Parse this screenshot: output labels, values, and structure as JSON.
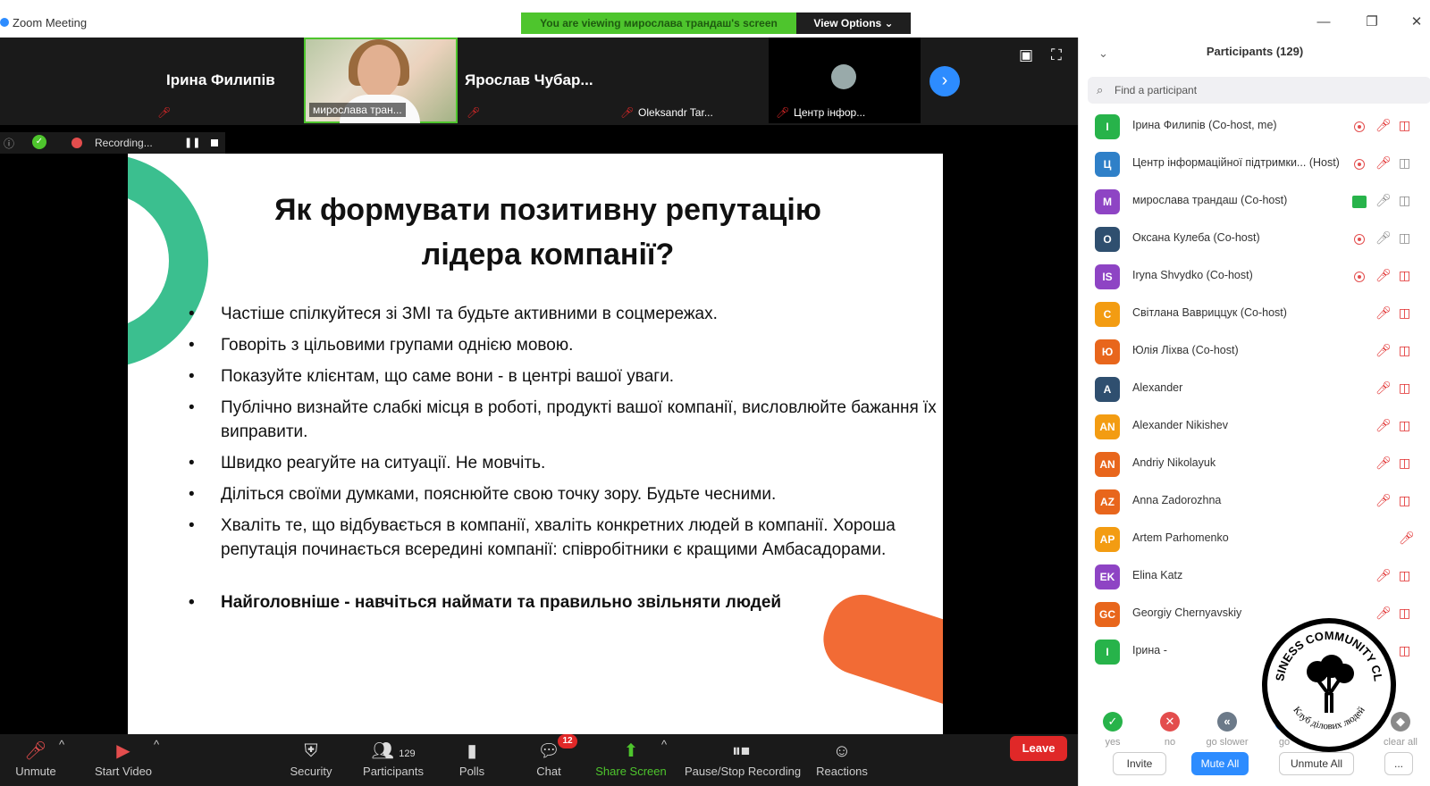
{
  "window": {
    "title": "Zoom Meeting",
    "viewing_banner": "You are viewing мирослава трандаш's screen",
    "view_options": "View Options ⌄"
  },
  "thumbnails": [
    {
      "name": "Ірина Филипів",
      "label": ""
    },
    {
      "name": "",
      "label": "мирослава тран..."
    },
    {
      "name": "Ярослав  Чубар...",
      "label": ""
    },
    {
      "name": "",
      "label": "Oleksandr Tar..."
    },
    {
      "name": "",
      "label": "Центр інфор..."
    }
  ],
  "recording": {
    "text": "Recording..."
  },
  "slide": {
    "title": "Як формувати позитивну репутацію\nлідера компанії?",
    "bullets": [
      "Частіше спілкуйтеся зі ЗМІ та будьте активними в соцмережах.",
      "Говоріть з цільовими групами однією мовою.",
      "Показуйте клієнтам, що саме вони - в центрі вашої уваги.",
      "Публічно визнайте слабкі місця в роботі, продукті вашої компанії, висловлюйте бажання їх виправити.",
      "Швидко реагуйте на ситуації. Не мовчіть.",
      "Діліться своїми думками, пояснюйте свою точку зору. Будьте чесними.",
      "Хваліть те, що відбувається в компанії, хваліть конкретних людей в компанії. Хороша репутація починається всередині компанії: співробітники є кращими Амбасадорами.",
      "Найголовніше - навчіться наймати та правильно звільняти людей"
    ]
  },
  "toolbar": {
    "unmute": "Unmute",
    "start_video": "Start Video",
    "security": "Security",
    "participants": "Participants",
    "participants_count": "129",
    "polls": "Polls",
    "chat": "Chat",
    "chat_badge": "12",
    "share_screen": "Share Screen",
    "pause_stop_recording": "Pause/Stop Recording",
    "reactions": "Reactions",
    "leave": "Leave"
  },
  "panel": {
    "title": "Participants (129)",
    "search_placeholder": "Find a participant",
    "participants": [
      {
        "initials": "І",
        "color": "#27b34a",
        "name": "Ірина Филипів (Co-host, me)"
      },
      {
        "initials": "Ц",
        "color": "#2f80c8",
        "name": "Центр інформаційної підтримки... (Host)"
      },
      {
        "initials": "М",
        "color": "#8e44c4",
        "name": "мирослава трандаш (Co-host)"
      },
      {
        "initials": "О",
        "color": "#2f4f6f",
        "name": "Оксана Кулеба (Co-host)"
      },
      {
        "initials": "IS",
        "color": "#8e44c4",
        "name": "Iryna Shvydko (Co-host)"
      },
      {
        "initials": "С",
        "color": "#f39c12",
        "name": "Світлана Вавриццук (Co-host)"
      },
      {
        "initials": "Ю",
        "color": "#e8661c",
        "name": "Юлія Ліхва (Co-host)"
      },
      {
        "initials": "A",
        "color": "#2f4f6f",
        "name": "Alexander"
      },
      {
        "initials": "AN",
        "color": "#f39c12",
        "name": "Alexander Nikishev"
      },
      {
        "initials": "AN",
        "color": "#e8661c",
        "name": "Andriy Nikolayuk"
      },
      {
        "initials": "AZ",
        "color": "#e8661c",
        "name": "Anna Zadorozhna"
      },
      {
        "initials": "AP",
        "color": "#f39c12",
        "name": "Artem Parhomenko"
      },
      {
        "initials": "EK",
        "color": "#8e44c4",
        "name": "Elina Katz"
      },
      {
        "initials": "GC",
        "color": "#e8661c",
        "name": "Georgiy Chernyavskiy"
      },
      {
        "initials": "І",
        "color": "#27b34a",
        "name": "Ірина -"
      }
    ],
    "reactions": [
      {
        "label": "yes",
        "color": "#27b34a",
        "glyph": "✓"
      },
      {
        "label": "no",
        "color": "#e34d4d",
        "glyph": "✕"
      },
      {
        "label": "go slower",
        "color": "#6c7a89",
        "glyph": "«"
      },
      {
        "label": "go",
        "color": "#2d8cff",
        "glyph": "»"
      },
      {
        "label": "clear all",
        "color": "#8a8a8a",
        "glyph": "◆"
      }
    ],
    "invite": "Invite",
    "mute_all": "Mute All",
    "unmute_all": "Unmute All",
    "more": "..."
  },
  "watermark": {
    "top_text": "BUSINESS COMMUNITY CLUB",
    "bottom_text": "Клуб ділових людей"
  }
}
